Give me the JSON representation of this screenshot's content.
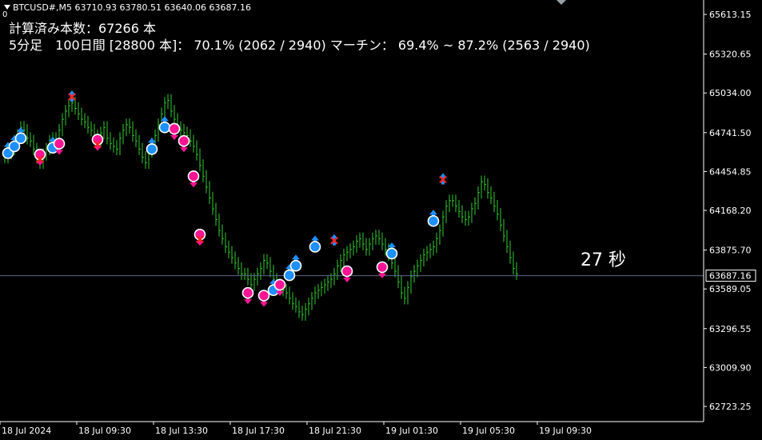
{
  "header": {
    "symbol_line": "BTCUSD#,M5  63710.93 63780.51 63640.06 63687.16",
    "zero_label": "0",
    "calc_line": "計算済み本数：67266 本",
    "stat_line": "5分足　100日間 [28800 本]：  70.1% (2062 / 2940) マーチン：  69.4% ~ 87.2% (2563 / 2940)"
  },
  "countdown": "27 秒",
  "colors": {
    "background": "#000000",
    "candles": "#32cd32",
    "up_arrow": "#1e90ff",
    "down_arrow": "#ff1493",
    "circle_win": "#1e90ff",
    "circle_loss": "#ff1493",
    "cross": "#ff2020",
    "price_line": "#5a6a8c",
    "axis": "#ffffff"
  },
  "chart_data": {
    "type": "line",
    "symbol": "BTCUSD#",
    "timeframe": "M5",
    "ohlc_last": {
      "open": 63710.93,
      "high": 63780.51,
      "low": 63640.06,
      "close": 63687.16
    },
    "current_price": 63687.16,
    "current_price_label": "63687.16",
    "ylim": [
      62580,
      65700
    ],
    "y_ticks": [
      65613.15,
      65320.65,
      65034.0,
      64741.5,
      64454.85,
      64168.2,
      63875.7,
      63589.05,
      63296.55,
      63009.9,
      62723.25
    ],
    "y_tick_labels": [
      "65613.15",
      "65320.65",
      "65034.00",
      "64741.50",
      "64454.85",
      "64168.20",
      "63875.70",
      "63589.05",
      "63296.55",
      "63009.90",
      "62723.25"
    ],
    "x_tick_labels": [
      "18 Jul 2024",
      "18 Jul 09:30",
      "18 Jul 13:30",
      "18 Jul 17:30",
      "18 Jul 21:30",
      "19 Jul 01:30",
      "19 Jul 05:30",
      "19 Jul 09:30"
    ],
    "x_tick_index": [
      0,
      24,
      48,
      72,
      96,
      120,
      144,
      168
    ],
    "series": [
      {
        "values": [
          64560,
          64590,
          64620,
          64680,
          64720,
          64780,
          64760,
          64700,
          64680,
          64620,
          64560,
          64520,
          64580,
          64620,
          64680,
          64700,
          64660,
          64760,
          64840,
          64900,
          64940,
          64960,
          64920,
          64880,
          64840,
          64820,
          64780,
          64760,
          64720,
          64680,
          64740,
          64780,
          64700,
          64660,
          64640,
          64620,
          64700,
          64760,
          64800,
          64780,
          64720,
          64680,
          64620,
          64560,
          64520,
          64600,
          64660,
          64720,
          64800,
          64880,
          64960,
          64980,
          64900,
          64840,
          64780,
          64760,
          64740,
          64720,
          64680,
          64640,
          64580,
          64500,
          64420,
          64340,
          64260,
          64180,
          64100,
          64020,
          63960,
          63900,
          63860,
          63820,
          63780,
          63740,
          63700,
          63700,
          63660,
          63620,
          63660,
          63700,
          63740,
          63800,
          63780,
          63720,
          63660,
          63620,
          63600,
          63580,
          63560,
          63520,
          63480,
          63460,
          63420,
          63400,
          63440,
          63480,
          63520,
          63560,
          63580,
          63600,
          63620,
          63640,
          63660,
          63700,
          63760,
          63800,
          63840,
          63860,
          63880,
          63900,
          63940,
          63960,
          63920,
          63880,
          63920,
          63960,
          63980,
          63960,
          63920,
          63880,
          63840,
          63780,
          63720,
          63640,
          63560,
          63520,
          63600,
          63680,
          63720,
          63760,
          63800,
          63840,
          63860,
          63880,
          63900,
          63960,
          64020,
          64120,
          64200,
          64240,
          64240,
          64200,
          64160,
          64120,
          64100,
          64120,
          64180,
          64220,
          64300,
          64380,
          64360,
          64300,
          64260,
          64200,
          64140,
          64060,
          63980,
          63900,
          63820,
          63740,
          63700
        ]
      }
    ],
    "signals": [
      {
        "i": 1,
        "p": 64590,
        "dir": "up",
        "circle": "win"
      },
      {
        "i": 3,
        "p": 64640,
        "dir": "up",
        "circle": "win"
      },
      {
        "i": 5,
        "p": 64700,
        "dir": "up",
        "circle": "win"
      },
      {
        "i": 11,
        "p": 64580,
        "dir": "down",
        "circle": "loss",
        "cross": true
      },
      {
        "i": 15,
        "p": 64630,
        "dir": "up",
        "circle": "win"
      },
      {
        "i": 17,
        "p": 64660,
        "dir": "down",
        "circle": "loss"
      },
      {
        "i": 21,
        "p": 64970,
        "dir": "up",
        "cross": true
      },
      {
        "i": 29,
        "p": 64690,
        "dir": "down",
        "circle": "loss",
        "cross": true
      },
      {
        "i": 46,
        "p": 64620,
        "dir": "up",
        "circle": "win"
      },
      {
        "i": 50,
        "p": 64780,
        "dir": "up",
        "circle": "win"
      },
      {
        "i": 53,
        "p": 64770,
        "dir": "down",
        "circle": "loss"
      },
      {
        "i": 56,
        "p": 64680,
        "dir": "down",
        "circle": "loss"
      },
      {
        "i": 59,
        "p": 64420,
        "dir": "down",
        "circle": "loss"
      },
      {
        "i": 61,
        "p": 63990,
        "dir": "down",
        "circle": "loss",
        "cross": true
      },
      {
        "i": 76,
        "p": 63560,
        "dir": "down",
        "circle": "loss"
      },
      {
        "i": 81,
        "p": 63540,
        "dir": "down",
        "circle": "loss"
      },
      {
        "i": 84,
        "p": 63580,
        "dir": "up",
        "circle": "win"
      },
      {
        "i": 86,
        "p": 63620,
        "dir": "down",
        "circle": "loss"
      },
      {
        "i": 89,
        "p": 63690,
        "dir": "up",
        "circle": "win"
      },
      {
        "i": 91,
        "p": 63760,
        "dir": "up",
        "circle": "win"
      },
      {
        "i": 97,
        "p": 63900,
        "dir": "up",
        "circle": "win"
      },
      {
        "i": 103,
        "p": 63910,
        "dir": "up",
        "cross": true
      },
      {
        "i": 107,
        "p": 63720,
        "dir": "down",
        "circle": "loss"
      },
      {
        "i": 118,
        "p": 63750,
        "dir": "down",
        "circle": "loss"
      },
      {
        "i": 121,
        "p": 63850,
        "dir": "up",
        "circle": "win"
      },
      {
        "i": 134,
        "p": 64090,
        "dir": "up",
        "circle": "win"
      },
      {
        "i": 137,
        "p": 64360,
        "dir": "up",
        "cross": true
      }
    ]
  }
}
